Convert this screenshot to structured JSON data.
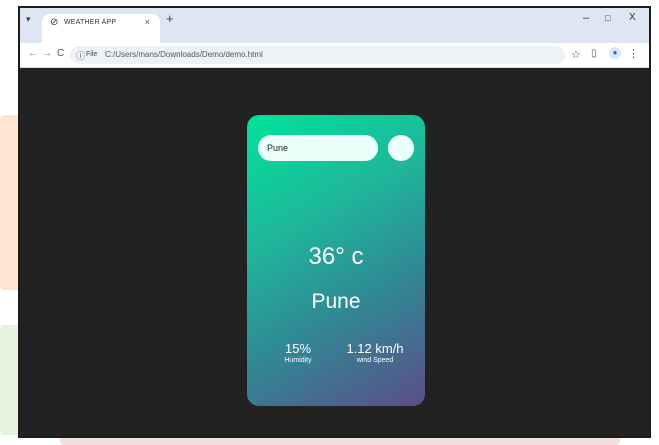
{
  "browser": {
    "tab_title": "WEATHER APP",
    "tab_close": "×",
    "new_tab": "+",
    "file_chip": "File",
    "url": "C:/Users/mans/Downloads/Demo/demo.html",
    "window_minimize": "–",
    "window_maximize": "□",
    "window_close": "X",
    "icons": [
      "tab-search-icon",
      "tab-favicon-icon",
      "back-icon",
      "forward-icon",
      "reload-icon",
      "info-icon",
      "star-icon",
      "side-panel-icon",
      "profile-icon",
      "menu-icon"
    ]
  },
  "weather": {
    "search_value": "Pune",
    "temperature": "36° c",
    "city": "Pune",
    "humidity_value": "15%",
    "humidity_label": "Humidity",
    "wind_value": "1.12 km/h",
    "wind_label": "wind Speed"
  },
  "colors": {
    "page_background": "#222222",
    "card_gradient_start": "#00e29b",
    "card_gradient_end": "#5b4e8a",
    "input_background": "#ebfffb"
  }
}
